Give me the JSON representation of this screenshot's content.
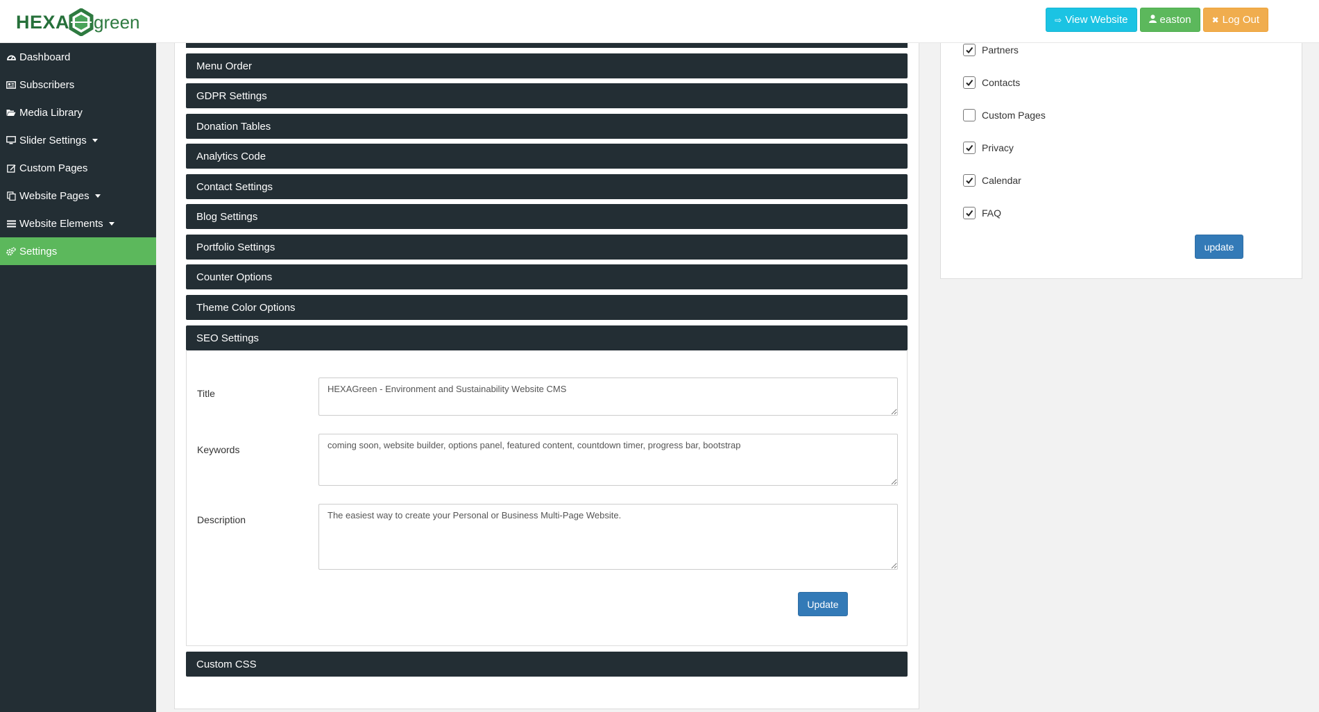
{
  "header": {
    "logo_left": "HEXA",
    "logo_right": "green",
    "view_website": "View Website",
    "user": "easton",
    "logout": "Log Out"
  },
  "sidebar": {
    "items": [
      {
        "label": "Dashboard",
        "icon": "dashboard-icon"
      },
      {
        "label": "Subscribers",
        "icon": "newspaper-icon"
      },
      {
        "label": "Media Library",
        "icon": "folder-open-icon"
      },
      {
        "label": "Slider Settings",
        "icon": "desktop-icon",
        "dropdown": true
      },
      {
        "label": "Custom Pages",
        "icon": "edit-icon"
      },
      {
        "label": "Website Pages",
        "icon": "copy-icon",
        "dropdown": true
      },
      {
        "label": "Website Elements",
        "icon": "bars-icon",
        "dropdown": true
      },
      {
        "label": "Settings",
        "icon": "cogs-icon",
        "active": true
      }
    ]
  },
  "accordion": {
    "menu_order": "Menu Order",
    "gdpr": "GDPR Settings",
    "donation": "Donation Tables",
    "analytics": "Analytics Code",
    "contact": "Contact Settings",
    "blog": "Blog Settings",
    "portfolio": "Portfolio Settings",
    "counter": "Counter Options",
    "theme_color": "Theme Color Options",
    "seo": "SEO Settings",
    "custom_css": "Custom CSS"
  },
  "seo": {
    "title_label": "Title",
    "title_value": "HEXAGreen - Environment and Sustainability Website CMS",
    "keywords_label": "Keywords",
    "keywords_value": "coming soon, website builder, options panel, featured content, countdown timer, progress bar, bootstrap",
    "description_label": "Description",
    "description_value": "The easiest way to create your Personal or Business Multi-Page Website.",
    "update_label": "Update"
  },
  "menu_visibility": {
    "items": [
      {
        "label": "Partners",
        "checked": true
      },
      {
        "label": "Contacts",
        "checked": true
      },
      {
        "label": "Custom Pages",
        "checked": false
      },
      {
        "label": "Privacy",
        "checked": true
      },
      {
        "label": "Calendar",
        "checked": true
      },
      {
        "label": "FAQ",
        "checked": true
      }
    ],
    "update_label": "update"
  },
  "colors": {
    "sidebar_bg": "#232e34",
    "active_green": "#5cb85c",
    "info": "#1bc3e3",
    "warning": "#f0ad4e",
    "primary": "#337ab7"
  }
}
